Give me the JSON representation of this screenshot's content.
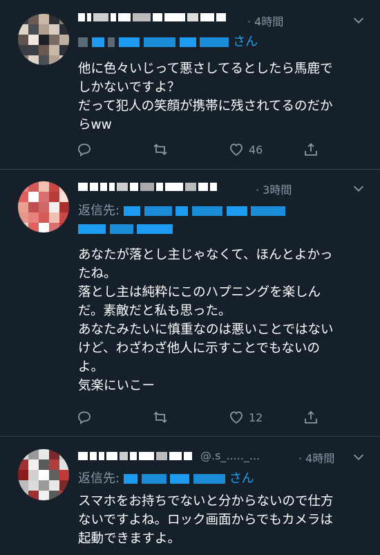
{
  "tweets": [
    {
      "time": "4時間",
      "reply_prefix": "",
      "mention_suffix": "さん",
      "lines": [
        "他に色々いじって悪さしてるとしたら馬鹿で",
        "しかないですよ？",
        "だって犯人の笑顔が携帯に残されてるのだか",
        "らww"
      ],
      "likes": "46",
      "avatar_colors": [
        "#3b3f45",
        "#6b5a52",
        "#c9b8a8",
        "#2d3036",
        "#8a7a70",
        "#e0d4c8",
        "#4a4f56",
        "#b2a090",
        "#d8ccc0",
        "#2a2d33",
        "#5e534c",
        "#f0e8e0",
        "#1e2126",
        "#7a6c62",
        "#c0b0a0",
        "#3a3e44"
      ]
    },
    {
      "time": "3時間",
      "reply_prefix": "返信先:",
      "mention_suffix": "",
      "lines": [
        "あなたが落とし主じゃなくて、ほんとよかっ",
        "たね。",
        "落とし主は純粋にこのハプニングを楽しん",
        "だ。素敵だと私も思った。",
        "あなたみたいに慎重なのは悪いことではない",
        "けど、わざわざ他人に示すことでもないの",
        "よ。",
        "気楽にいこー"
      ],
      "likes": "12",
      "avatar_colors": [
        "#e88080",
        "#d45a5a",
        "#f2c0b0",
        "#c84848",
        "#f0d0c0",
        "#e06060",
        "#ffffff",
        "#d87070",
        "#b83c3c",
        "#f8e0d8",
        "#e8a090",
        "#c05050",
        "#d06868",
        "#f0f0f0",
        "#a83030",
        "#e89888"
      ]
    },
    {
      "time": "4時間",
      "reply_prefix": "返信先:",
      "mention_suffix": "さん",
      "name_tail": "@.s_....._...",
      "lines": [
        "スマホをお持ちでないと分からないので仕方",
        "ないですよね。ロック画面からでもカメラは",
        "起動できますよ。"
      ],
      "avatar_colors": [
        "#dcdcdc",
        "#9a9a9a",
        "#e8e8e8",
        "#7a2a2a",
        "#c8c8c8",
        "#a03030",
        "#f0f0f0",
        "#5a5a5a",
        "#b04040",
        "#e0e0e0",
        "#8a1c1c",
        "#d0d0d0",
        "#ffffff",
        "#606060",
        "#c03a3a",
        "#bcbcbc"
      ]
    }
  ],
  "colors": {
    "background": "#15202b",
    "secondary": "#8899a6",
    "link": "#1da1f2",
    "divider": "#38444d"
  },
  "icons": [
    "reply-icon",
    "retweet-icon",
    "like-icon",
    "share-icon",
    "chevron-down-icon"
  ]
}
